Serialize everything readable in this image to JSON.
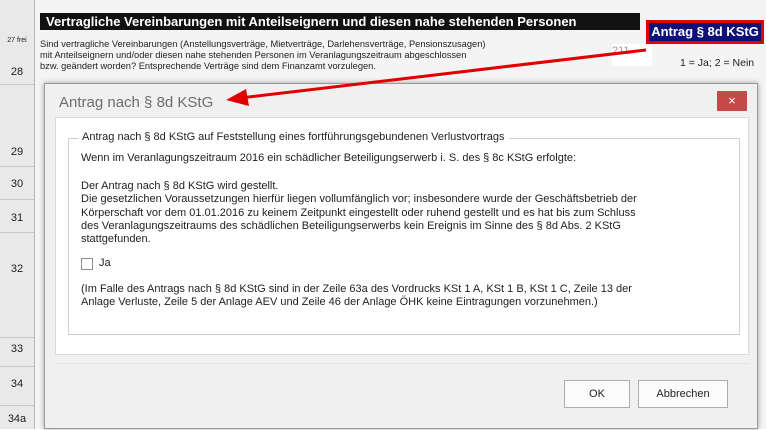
{
  "form": {
    "title": "Vertragliche Vereinbarungen mit Anteilseignern und diesen nahe stehenden Personen",
    "description_lines": [
      "Sind vertragliche Vereinbarungen (Anstellungsverträge, Mietverträge, Darlehensverträge, Pensionszusagen)",
      "mit Anteilseignern und/oder diesen nahe stehenden Personen im Veranlagungszeitraum abgeschlossen",
      "bzw. geändert worden? Entsprechende Verträge sind dem Finanzamt vorzulegen."
    ],
    "antrag_badge": "Antrag § 8d KStG",
    "field_code": "211",
    "hint": "1 = Ja; 2 = Nein",
    "row_numbers": [
      "27 frei",
      "28",
      "29",
      "30",
      "31",
      "32",
      "33",
      "34",
      "34a"
    ]
  },
  "dialog": {
    "title": "Antrag nach § 8d KStG",
    "close_label": "×",
    "group_legend": "Antrag nach § 8d KStG auf Feststellung eines fortführungsgebundenen Verlustvortrags",
    "intro": "Wenn im Veranlagungszeitraum 2016 ein schädlicher Beteiligungserwerb i. S. des § 8c KStG erfolgte:",
    "statement_lines": [
      "Der Antrag nach § 8d KStG wird gestellt.",
      "Die gesetzlichen Voraussetzungen hierfür liegen vollumfänglich vor; insbesondere wurde der Geschäftsbetrieb der",
      "Körperschaft vor dem 01.01.2016 zu keinem Zeitpunkt eingestellt oder ruhend gestellt und es hat bis zum Schluss",
      "des Veranlagungszeitraums des schädlichen Beteiligungserwerbs kein Ereignis im Sinne des § 8d Abs. 2 KStG",
      "stattgefunden."
    ],
    "checkbox_label": "Ja",
    "checkbox_checked": false,
    "note_lines": [
      "(Im Falle des Antrags nach § 8d KStG sind in der Zeile 63a des Vordrucks KSt 1 A, KSt 1 B, KSt 1 C, Zeile 13 der",
      "Anlage Verluste, Zeile 5 der Anlage AEV und Zeile 46 der Anlage ÖHK keine Eintragungen vorzunehmen.)"
    ],
    "ok_label": "OK",
    "cancel_label": "Abbrechen"
  },
  "colors": {
    "arrow": "#e00000",
    "badge_bg": "#10107a",
    "close_bg": "#c44a4a"
  }
}
